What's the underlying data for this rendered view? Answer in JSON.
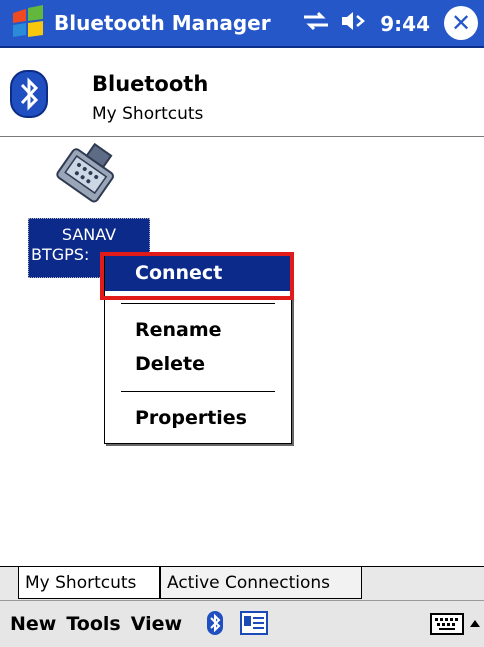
{
  "titlebar": {
    "app_title": "Bluetooth Manager",
    "time": "9:44",
    "icons": [
      "windows-start-icon",
      "connectivity-icon",
      "volume-icon",
      "close-icon"
    ]
  },
  "header": {
    "title": "Bluetooth",
    "subtitle": "My Shortcuts",
    "icon": "bluetooth-icon"
  },
  "content": {
    "device": {
      "icon": "serial-connector-icon",
      "label_line1": "SANAV",
      "label_line2": "BTGPS:"
    },
    "context_menu": {
      "items": [
        {
          "label": "Connect",
          "selected": true
        },
        {
          "label": "Rename"
        },
        {
          "label": "Delete"
        },
        {
          "label": "Properties"
        }
      ]
    }
  },
  "tabs": {
    "items": [
      {
        "label": "My Shortcuts"
      },
      {
        "label": "Active Connections"
      }
    ]
  },
  "menubar": {
    "items": [
      {
        "label": "New"
      },
      {
        "label": "Tools"
      },
      {
        "label": "View"
      }
    ],
    "icons": [
      "bluetooth-menu-icon",
      "contacts-card-icon",
      "keyboard-icon",
      "sip-arrow-icon"
    ]
  },
  "colors": {
    "titlebar": "#2557c9",
    "selection": "#0c2a8a",
    "highlight": "#e11a1a"
  }
}
